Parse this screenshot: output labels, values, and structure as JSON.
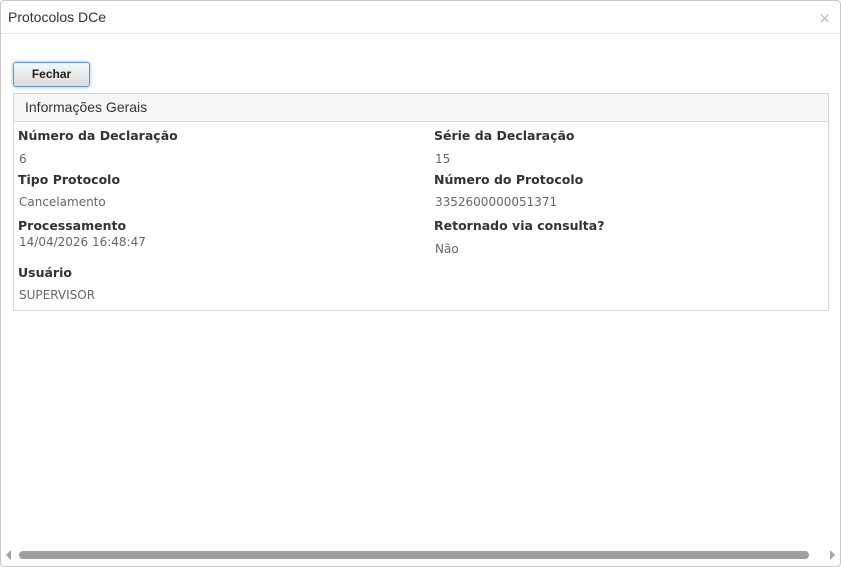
{
  "dialog": {
    "title": "Protocolos DCe",
    "close_label": "×"
  },
  "toolbar": {
    "close_button_label": "Fechar"
  },
  "panel": {
    "heading": "Informações Gerais",
    "fields": {
      "numero_declaracao": {
        "label": "Número da Declaração",
        "value": "6"
      },
      "serie_declaracao": {
        "label": "Série da Declaração",
        "value": "15"
      },
      "tipo_protocolo": {
        "label": "Tipo Protocolo",
        "value": "Cancelamento"
      },
      "numero_protocolo": {
        "label": "Número do Protocolo",
        "value": "3352600000051371"
      },
      "processamento": {
        "label": "Processamento",
        "value": "14/04/2026 16:48:47"
      },
      "retornado_consulta": {
        "label": "Retornado via consulta?",
        "value": "Não"
      },
      "usuario": {
        "label": "Usuário",
        "value": "SUPERVISOR"
      }
    }
  }
}
